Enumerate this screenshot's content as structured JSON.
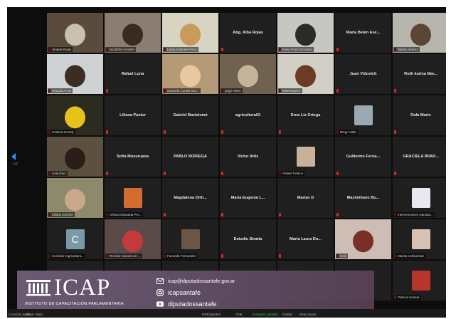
{
  "participants": [
    {
      "name": "Jimena Rojas",
      "video": true,
      "bg": "#5a4b3c",
      "accent": "#c9c1ae"
    },
    {
      "name": "VALERIA SAUNA",
      "video": true,
      "bg": "#8a7d72",
      "accent": "#3a2a22"
    },
    {
      "name": "Laura Gabriela Ferro",
      "video": true,
      "bg": "#d7d4c2",
      "accent": "#c99a5a",
      "active": true
    },
    {
      "name": "Abg. Alba Rojas",
      "video": false
    },
    {
      "name": "Ivana Perez Ecuador",
      "video": true,
      "bg": "#c8c6c0",
      "accent": "#2a2a2a"
    },
    {
      "name": "Maria Belen Ase...",
      "video": false
    },
    {
      "name": "Martin Alvarez",
      "video": true,
      "bg": "#b7b5ad",
      "accent": "#5b4534"
    },
    {
      "name": "Claudia Arruti",
      "video": true,
      "bg": "#cfd2d4",
      "accent": "#3c2d24"
    },
    {
      "name": "Rafael Luna",
      "video": false
    },
    {
      "name": "antonela Contini Gia...",
      "video": true,
      "bg": "#b59a78",
      "accent": "#e8c8a0"
    },
    {
      "name": "jorge rivero",
      "video": true,
      "bg": "#6f6350",
      "accent": "#c4b59a"
    },
    {
      "name": "MERCEDES",
      "video": true,
      "bg": "#d1cfc6",
      "accent": "#6b3b24"
    },
    {
      "name": "Juan Vidovich",
      "video": false
    },
    {
      "name": "Ruth karina Mar...",
      "video": false
    },
    {
      "name": "Cristina Kroszp",
      "video": true,
      "bg": "#2b2b20",
      "accent": "#e6c21a"
    },
    {
      "name": "Liliana Pastur",
      "video": false
    },
    {
      "name": "Gabriel Bartolomé",
      "video": false
    },
    {
      "name": "agricultura02",
      "video": false
    },
    {
      "name": "Dora Liz Ortega",
      "video": false
    },
    {
      "name": "Diego Valla",
      "video": true,
      "bg": "#2a2a2a",
      "accent": "#9aa8b4",
      "thumb": true
    },
    {
      "name": "Rafa Marin",
      "video": false
    },
    {
      "name": "Julia Ruiz",
      "video": true,
      "bg": "#5c5040",
      "accent": "#2b1e18"
    },
    {
      "name": "Sofia Musuruana",
      "video": false
    },
    {
      "name": "PABLO NORIEGA",
      "video": false
    },
    {
      "name": "Victor Attis",
      "video": false
    },
    {
      "name": "Rafael Trebino",
      "video": true,
      "bg": "#2a2a2a",
      "accent": "#c7b199",
      "thumb": true
    },
    {
      "name": "Guillermo Ferna...",
      "video": false
    },
    {
      "name": "GRACIELA IRIAR...",
      "video": false
    },
    {
      "name": "Liliana Karcher",
      "video": true,
      "bg": "#8d8a6b",
      "accent": "#c9a98a"
    },
    {
      "name": "Oficina Diputada Pro...",
      "video": true,
      "bg": "#2a2a2a",
      "accent": "#d46b2f",
      "thumb": true
    },
    {
      "name": "Magdalena Orih...",
      "video": false
    },
    {
      "name": "Maria Eugenia L...",
      "video": false
    },
    {
      "name": "Marian D",
      "video": false
    },
    {
      "name": "Maximiliano Bu...",
      "video": false
    },
    {
      "name": "Intervenciones Diputad...",
      "video": true,
      "bg": "#2a2a2a",
      "accent": "#e8e8f0",
      "thumb": true
    },
    {
      "name": "Comisión Agricultura...",
      "video": true,
      "bg": "#2a2a2a",
      "accent": "#7a9aa6",
      "thumb": true,
      "letter": "C"
    },
    {
      "name": "Recinto Camara de ...",
      "video": true,
      "bg": "#5b4a4a",
      "accent": "#c23a3a"
    },
    {
      "name": "Facundo Fernandez",
      "video": true,
      "bg": "#2a2a2a",
      "accent": "#6b5544",
      "thumb": true
    },
    {
      "name": "Estudio Stratta",
      "video": false
    },
    {
      "name": "Maria Laura Du...",
      "video": false
    },
    {
      "name": "Celo",
      "video": true,
      "bg": "#cdbdb5",
      "accent": "#7a2e28"
    },
    {
      "name": "Marisa Urdinarrain",
      "video": true,
      "bg": "#2a2a2a",
      "accent": "#d8c2b4",
      "thumb": true
    },
    {
      "name": "",
      "video": false
    },
    {
      "name": "",
      "video": false
    },
    {
      "name": "",
      "video": false
    },
    {
      "name": "",
      "video": false
    },
    {
      "name": "",
      "video": false
    },
    {
      "name": "",
      "video": false
    },
    {
      "name": "Patricia Huseia",
      "video": true,
      "bg": "#2a2a2a",
      "accent": "#b7352a",
      "thumb": true
    }
  ],
  "nav": {
    "page": "1/2"
  },
  "banner": {
    "title": "ICAP",
    "subtitle": "INSTITUTO DE CAPACITACIÓN PARLAMENTARIA",
    "email": "icap@diputadossantafe.gov.ar",
    "instagram": "icapsantafe",
    "youtube": "diputadossantafe"
  },
  "toolbar": {
    "mute": "Conectar audio",
    "video": "Iniciar video",
    "participants": "Participantes",
    "chat": "Chat",
    "share": "Compartir pantalla",
    "record": "Grabar",
    "reactions": "Reacciones"
  },
  "colors": {
    "accent": "#2d8cff",
    "active_speaker": "#d8e34a",
    "muted": "#e0251f",
    "banner": "#5e4b62"
  }
}
